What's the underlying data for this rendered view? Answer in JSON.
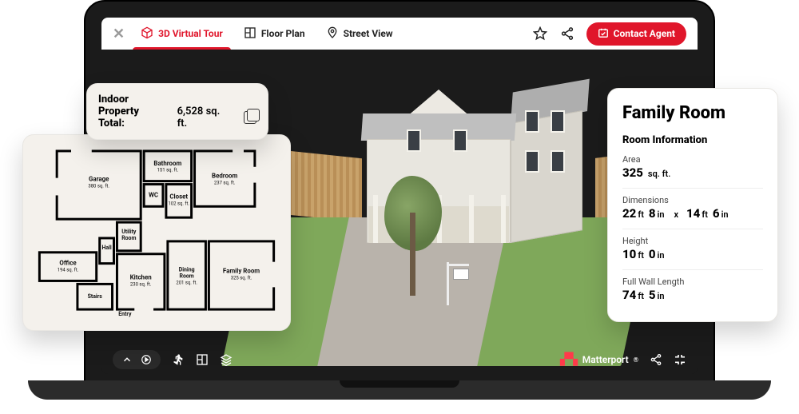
{
  "topbar": {
    "tabs": [
      {
        "label": "3D Virtual Tour",
        "icon": "cube-icon"
      },
      {
        "label": "Floor Plan",
        "icon": "floorplan-icon"
      },
      {
        "label": "Street View",
        "icon": "pin-icon"
      }
    ],
    "contact_label": "Contact Agent"
  },
  "totals": {
    "line1": "Indoor",
    "line2_label": "Property Total:",
    "value": "6,528",
    "unit": "sq. ft."
  },
  "floorplan": {
    "rooms": [
      {
        "name": "Garage",
        "area": "380 sq. ft."
      },
      {
        "name": "Bathroom",
        "area": "151 sq. ft."
      },
      {
        "name": "Bedroom",
        "area": "237 sq. ft."
      },
      {
        "name": "WC",
        "area": ""
      },
      {
        "name": "Closet",
        "area": "102 sq. ft."
      },
      {
        "name": "Utility Room",
        "area": ""
      },
      {
        "name": "Hall",
        "area": ""
      },
      {
        "name": "Office",
        "area": "194 sq. ft."
      },
      {
        "name": "Kitchen",
        "area": "230 sq. ft."
      },
      {
        "name": "Dining Room",
        "area": "201 sq. ft."
      },
      {
        "name": "Family Room",
        "area": "325 sq. ft."
      },
      {
        "name": "Stairs",
        "area": ""
      },
      {
        "name": "Entry",
        "area": ""
      }
    ]
  },
  "room_panel": {
    "title": "Family Room",
    "section": "Room Information",
    "area": {
      "label": "Area",
      "value": "325",
      "unit": "sq. ft."
    },
    "dimensions": {
      "label": "Dimensions",
      "w_ft": "22",
      "w_in": "8",
      "d_ft": "14",
      "d_in": "6"
    },
    "height": {
      "label": "Height",
      "ft": "10",
      "in": "0"
    },
    "wall": {
      "label": "Full Wall Length",
      "ft": "74",
      "in": "5"
    },
    "ft_unit": "ft",
    "in_unit": "in",
    "times": "x"
  },
  "brand": "Matterport"
}
